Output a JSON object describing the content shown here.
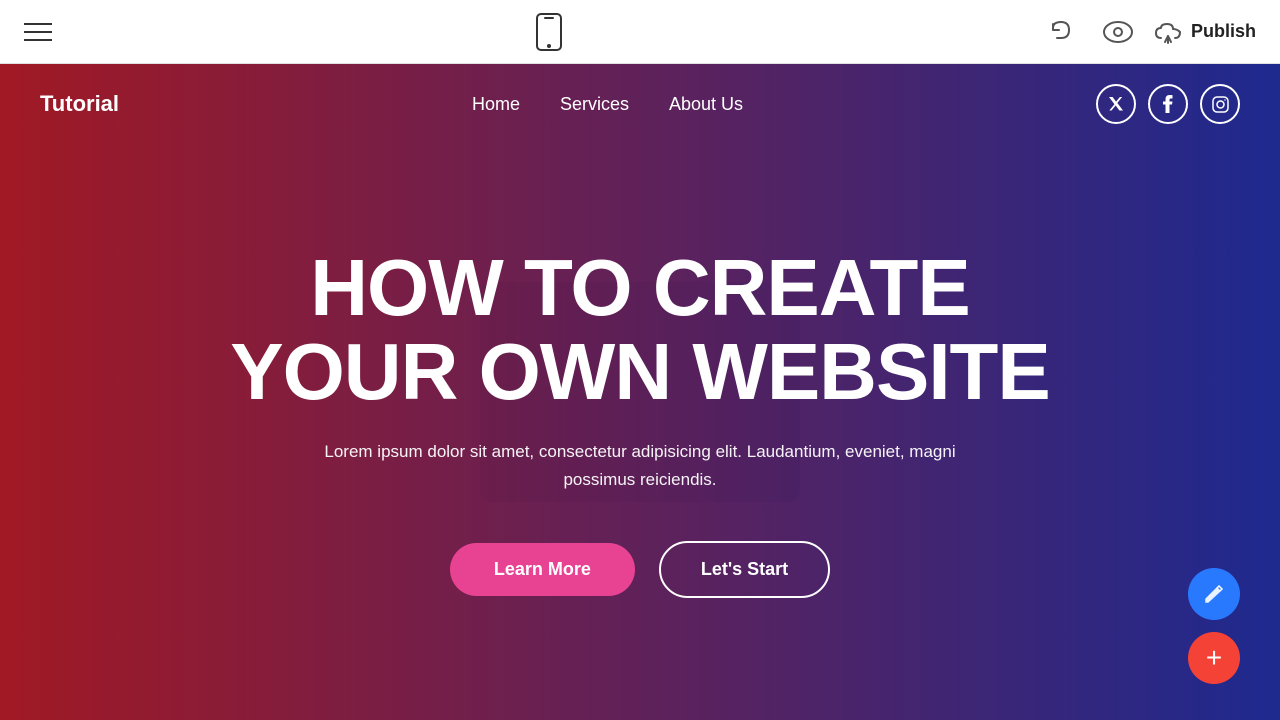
{
  "toolbar": {
    "hamburger_label": "menu",
    "phone_preview_label": "mobile preview",
    "undo_label": "undo",
    "preview_label": "preview",
    "publish_label": "Publish",
    "publish_icon": "cloud-upload"
  },
  "site": {
    "logo": "Tutorial",
    "nav": {
      "links": [
        {
          "label": "Home"
        },
        {
          "label": "Services"
        },
        {
          "label": "About Us"
        }
      ],
      "social": [
        {
          "label": "Twitter",
          "icon": "𝕏"
        },
        {
          "label": "Facebook",
          "icon": "f"
        },
        {
          "label": "Instagram",
          "icon": "📷"
        }
      ]
    },
    "hero": {
      "title_line1": "HOW TO CREATE",
      "title_line2": "YOUR OWN WEBSITE",
      "subtitle": "Lorem ipsum dolor sit amet, consectetur adipisicing elit. Laudantium, eveniet, magni possimus reiciendis.",
      "btn_learn_more": "Learn More",
      "btn_lets_start": "Let's Start"
    }
  },
  "fabs": {
    "edit_icon": "✏",
    "add_icon": "+"
  }
}
